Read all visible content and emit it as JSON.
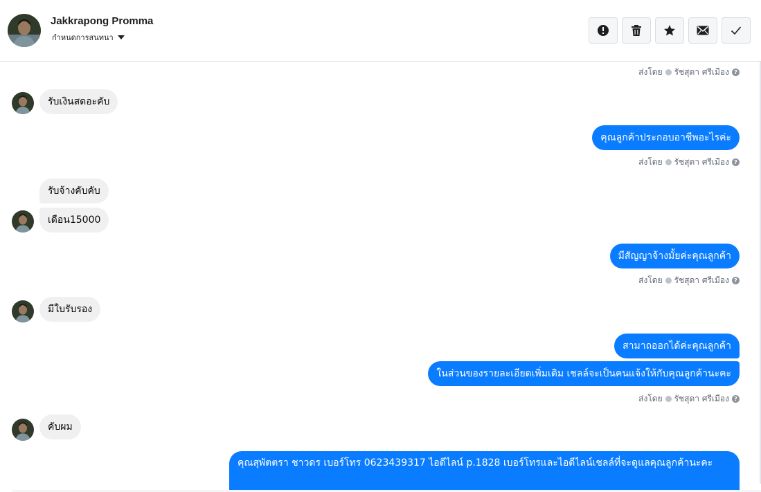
{
  "header": {
    "name": "Jakkrapong Promma",
    "assign_label": "กำหนดการสนทนา",
    "toolbar": [
      {
        "name": "spam-button",
        "icon": "alert-icon"
      },
      {
        "name": "delete-button",
        "icon": "trash-icon"
      },
      {
        "name": "star-button",
        "icon": "star-icon"
      },
      {
        "name": "mark-unread-button",
        "icon": "envelope-icon"
      },
      {
        "name": "done-button",
        "icon": "check-icon"
      }
    ]
  },
  "sent_by": {
    "prefix": "ส่งโดย",
    "agent": "รัชสุดา ศรีเมือง"
  },
  "messages": {
    "m1": "รับเงินสดอะคับ",
    "m2": "คุณลูกค้าประกอบอาชีพอะไรค่ะ",
    "m3": "รับจ้างคับคับ",
    "m4": "เดือน15000",
    "m5": "มีสัญญาจ้างมั้ยค่ะคุณลูกค้า",
    "m6": "มีใบรับรอง",
    "m7": "สามาถออกได้ค่ะคุณลูกค้า",
    "m8": "ในส่วนของรายละเอียดเพิ่มเติม เชลล์จะเป็นคนแจ้งให้กับคุณลูกค้านะคะ",
    "m9": "คับผม",
    "m10": "คุณสุพัตตรา   ชาวดร      เบอร์โทร 0623439317  ไอดีไลน์ p.1828   เบอร์โทรและไอดีไลน์เชลล์ที่จะดูแลคุณลูกค้านะคะ"
  },
  "colors": {
    "outgoing_bubble": "#0a7cff",
    "incoming_bubble": "#f0f0f0"
  }
}
